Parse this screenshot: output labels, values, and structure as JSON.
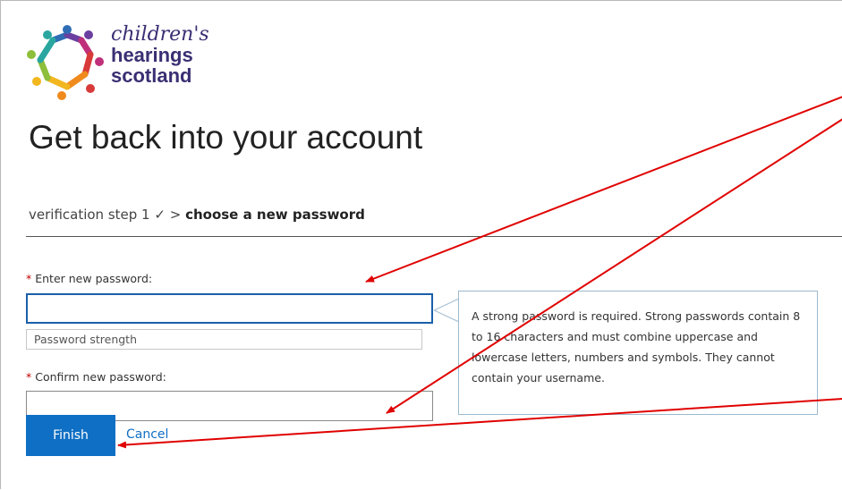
{
  "logo": {
    "line1": "children's",
    "line2": "hearings",
    "line3": "scotland"
  },
  "page": {
    "title": "Get back into your account"
  },
  "breadcrumb": {
    "step1": "verification step 1 ✓",
    "separator": ">",
    "current": "choose a new password"
  },
  "form": {
    "new_password_required": "*",
    "new_password_label": "Enter new password:",
    "new_password_value": "",
    "strength_label": "Password strength",
    "confirm_password_required": "*",
    "confirm_password_label": "Confirm new password:",
    "confirm_password_value": "",
    "finish_label": "Finish",
    "cancel_label": "Cancel"
  },
  "tooltip": {
    "text": "A strong password is required. Strong passwords contain 8 to 16 characters and must combine uppercase and lowercase letters, numbers and symbols. They cannot contain your username."
  },
  "colors": {
    "accent": "#0f6fc4",
    "required": "#c00000",
    "annotation_arrow": "#e00000",
    "focus_border": "#1b5fa8"
  },
  "icons": {
    "logo": "children-circle-logo-icon"
  }
}
